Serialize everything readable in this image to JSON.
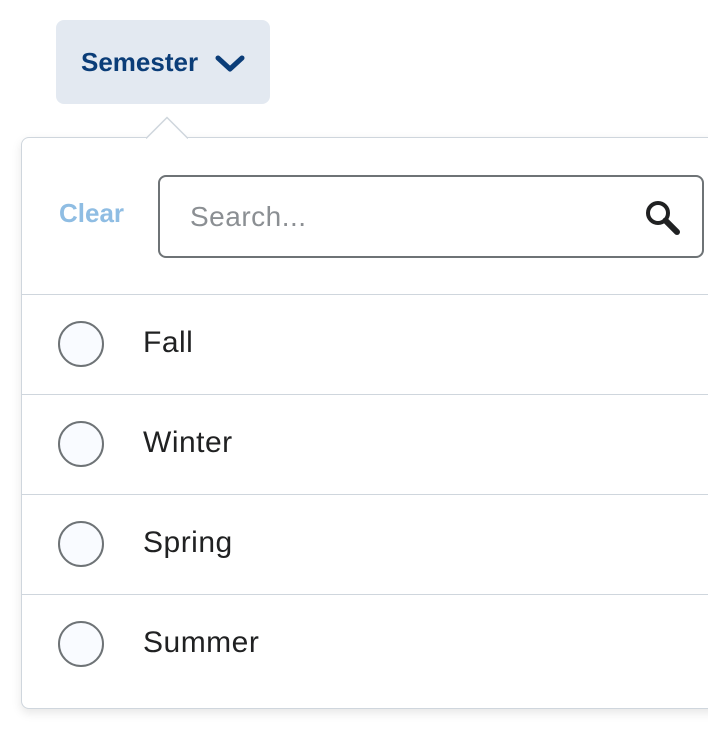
{
  "filter": {
    "button_label": "Semester",
    "button_icon": "chevron-down-icon",
    "accent_color": "#0b3d78"
  },
  "dropdown": {
    "clear_label": "Clear",
    "search": {
      "placeholder": "Search...",
      "value": "",
      "icon": "search-icon"
    },
    "options": [
      {
        "label": "Fall",
        "selected": false
      },
      {
        "label": "Winter",
        "selected": false
      },
      {
        "label": "Spring",
        "selected": false
      },
      {
        "label": "Summer",
        "selected": false
      }
    ]
  }
}
